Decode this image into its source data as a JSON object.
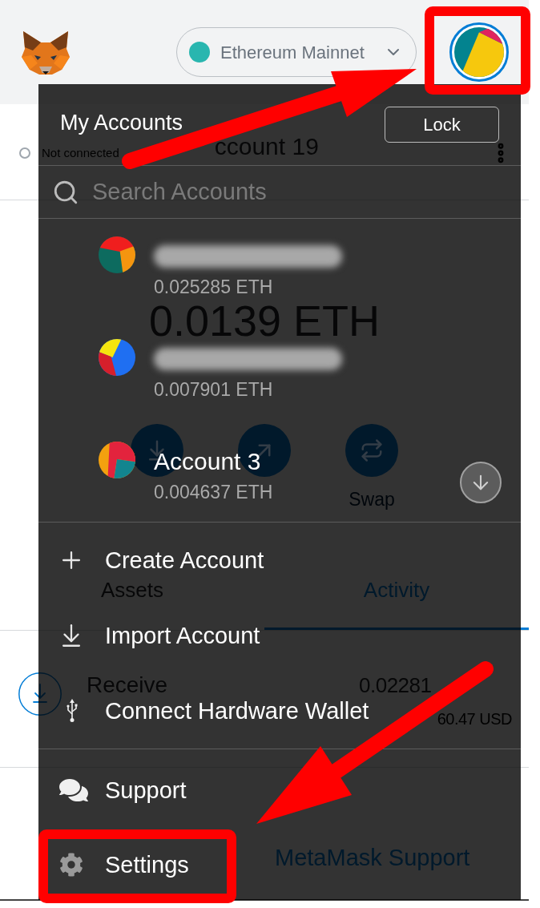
{
  "header": {
    "network": "Ethereum Mainnet"
  },
  "account": {
    "status": "Not connected",
    "name": "ccount 19"
  },
  "balance": "0.0139 ETH",
  "actions": [
    {
      "kind": "buy"
    },
    {
      "kind": "send"
    },
    {
      "kind": "swap",
      "label": "Swap"
    }
  ],
  "tabs": [
    {
      "label": "Assets",
      "selected": false
    },
    {
      "label": "Activity",
      "selected": true
    }
  ],
  "activity": [
    {
      "kind": "receive",
      "title": "Receive",
      "amount": "0.02281",
      "fiat": "60.47 USD"
    }
  ],
  "help": {
    "link": "MetaMask Support"
  },
  "menu": {
    "title": "My Accounts",
    "lock": "Lock",
    "search": {
      "placeholder": "Search Accounts"
    },
    "accounts": [
      {
        "blurred": true,
        "balance": "0.025285 ETH"
      },
      {
        "blurred": true,
        "balance": "0.007901 ETH"
      },
      {
        "blurred": false,
        "name": "Account 3",
        "balance": "0.004637 ETH"
      }
    ],
    "actions": [
      {
        "kind": "create",
        "label": "Create Account"
      },
      {
        "kind": "import",
        "label": "Import Account"
      },
      {
        "kind": "hardware",
        "label": "Connect Hardware Wallet"
      }
    ],
    "links": [
      {
        "kind": "support",
        "label": "Support"
      },
      {
        "kind": "settings",
        "label": "Settings"
      }
    ]
  }
}
